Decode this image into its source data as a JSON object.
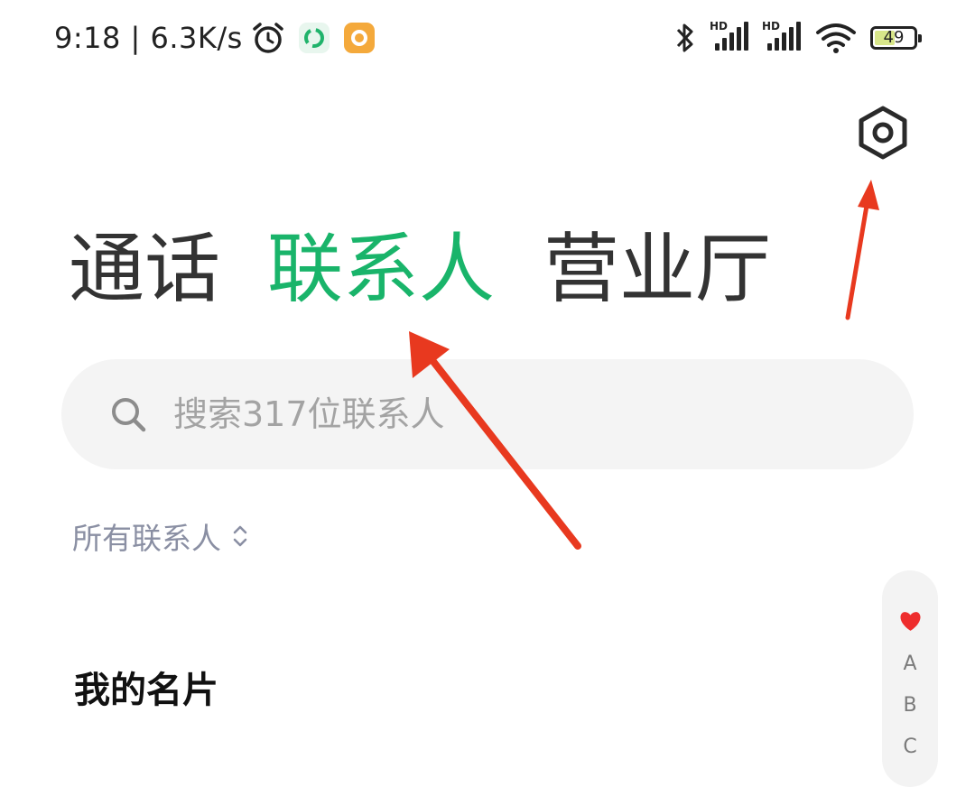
{
  "status_bar": {
    "time": "9:18 | 6.3K/s",
    "battery": "49",
    "signal1_label": "HD",
    "signal2_label": "HD",
    "icons": [
      "alarm-icon",
      "green-app-icon",
      "orange-app-icon",
      "bluetooth-icon",
      "signal-icon",
      "signal-icon",
      "wifi-icon",
      "battery-icon"
    ]
  },
  "header": {
    "settings_icon": "settings-hexagon-icon"
  },
  "tabs": [
    {
      "label": "通话",
      "active": false
    },
    {
      "label": "联系人",
      "active": true
    },
    {
      "label": "营业厅",
      "active": false
    }
  ],
  "search": {
    "placeholder": "搜索317位联系人"
  },
  "filter": {
    "label": "所有联系人"
  },
  "my_card": {
    "title": "我的名片"
  },
  "index_bar": {
    "items": [
      "♥",
      "A",
      "B",
      "C"
    ]
  },
  "colors": {
    "accent": "#19b46a",
    "annotation": "#e8391f",
    "favorite": "#ee2d2d"
  }
}
